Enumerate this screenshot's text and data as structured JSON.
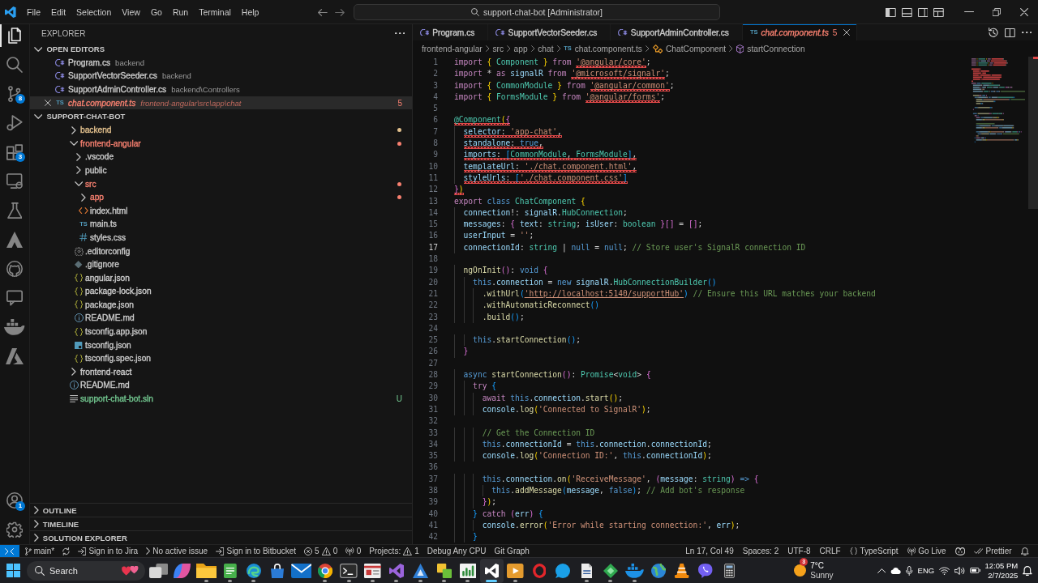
{
  "title_bar": {
    "menu": [
      "File",
      "Edit",
      "Selection",
      "View",
      "Go",
      "Run",
      "Terminal",
      "Help"
    ],
    "command_center": "support-chat-bot [Administrator]"
  },
  "activity_bar": {
    "items": [
      {
        "kind": "explorer",
        "selected": true
      },
      {
        "kind": "search",
        "selected": false
      },
      {
        "kind": "scm",
        "selected": false,
        "badge": "8"
      },
      {
        "kind": "debug",
        "selected": false
      },
      {
        "kind": "extensions",
        "selected": false,
        "badge": "3"
      },
      {
        "kind": "remote",
        "selected": false
      },
      {
        "kind": "testing",
        "selected": false
      },
      {
        "kind": "peak",
        "selected": false
      },
      {
        "kind": "github",
        "selected": false
      },
      {
        "kind": "chat",
        "selected": false
      },
      {
        "kind": "docker",
        "selected": false
      },
      {
        "kind": "azure",
        "selected": false
      }
    ],
    "bottom_items": [
      {
        "kind": "account",
        "badge": "1"
      },
      {
        "kind": "settings"
      }
    ]
  },
  "sidebar": {
    "title": "EXPLORER",
    "open_editors": {
      "title": "OPEN EDITORS",
      "expanded": true,
      "items": [
        {
          "name": "Program.cs",
          "path": "backend",
          "kind": "csharp",
          "color": "#cccccc",
          "preview": false,
          "selected": false
        },
        {
          "name": "SupportVectorSeeder.cs",
          "path": "backend",
          "kind": "csharp",
          "color": "#cccccc",
          "preview": false,
          "selected": false
        },
        {
          "name": "SupportAdminController.cs",
          "path": "backend\\Controllers",
          "kind": "csharp",
          "color": "#cccccc",
          "preview": false,
          "selected": false
        },
        {
          "name": "chat.component.ts",
          "path": "frontend-angular\\src\\app\\chat",
          "kind": "ts",
          "icon_text": "TS",
          "color": "#f88070",
          "preview": true,
          "selected": true,
          "problems": "5"
        }
      ]
    },
    "folder": {
      "title": "SUPPORT-CHAT-BOT",
      "expanded": true,
      "tree": [
        {
          "name": "backend",
          "kind": "folder",
          "expanded": false,
          "color": "#e2c08d",
          "dot": true
        },
        {
          "name": "frontend-angular",
          "kind": "folder",
          "expanded": true,
          "color": "#f88070",
          "dot": true,
          "children": [
            {
              "name": ".vscode",
              "kind": "folder",
              "expanded": false,
              "color": "#cccccc"
            },
            {
              "name": "public",
              "kind": "folder",
              "expanded": false,
              "color": "#cccccc"
            },
            {
              "name": "src",
              "kind": "folder",
              "expanded": true,
              "color": "#f88070",
              "dot": true,
              "children": [
                {
                  "name": "app",
                  "kind": "folder",
                  "expanded": false,
                  "color": "#f88070",
                  "dot": true
                },
                {
                  "name": "index.html",
                  "kind": "html",
                  "color": "#cccccc"
                },
                {
                  "name": "main.ts",
                  "kind": "ts",
                  "icon_text": "TS",
                  "color": "#cccccc"
                },
                {
                  "name": "styles.css",
                  "kind": "css",
                  "color": "#cccccc"
                }
              ]
            },
            {
              "name": ".editorconfig",
              "kind": "config",
              "color": "#cccccc"
            },
            {
              "name": ".gitignore",
              "kind": "git",
              "color": "#cccccc"
            },
            {
              "name": "angular.json",
              "kind": "json",
              "color": "#cccccc"
            },
            {
              "name": "package-lock.json",
              "kind": "json",
              "color": "#cccccc"
            },
            {
              "name": "package.json",
              "kind": "json",
              "color": "#cccccc"
            },
            {
              "name": "README.md",
              "kind": "info",
              "color": "#cccccc"
            },
            {
              "name": "tsconfig.app.json",
              "kind": "json",
              "color": "#cccccc"
            },
            {
              "name": "tsconfig.json",
              "kind": "tsconfig",
              "color": "#cccccc"
            },
            {
              "name": "tsconfig.spec.json",
              "kind": "json",
              "color": "#cccccc"
            }
          ]
        },
        {
          "name": "frontend-react",
          "kind": "folder",
          "expanded": false,
          "color": "#cccccc"
        },
        {
          "name": "README.md",
          "kind": "info",
          "color": "#cccccc"
        },
        {
          "name": "support-chat-bot.sln",
          "kind": "solution",
          "color": "#73c991",
          "badge": "U"
        }
      ]
    },
    "sections": [
      {
        "title": "OUTLINE",
        "expanded": false
      },
      {
        "title": "TIMELINE",
        "expanded": false
      },
      {
        "title": "SOLUTION EXPLORER",
        "expanded": false
      }
    ]
  },
  "editor": {
    "tabs": [
      {
        "label": "Program.cs",
        "kind": "csharp",
        "color": "#cccccc",
        "preview": false,
        "selected": false
      },
      {
        "label": "SupportVectorSeeder.cs",
        "kind": "csharp",
        "color": "#cccccc",
        "preview": false,
        "selected": false
      },
      {
        "label": "SupportAdminController.cs",
        "kind": "csharp",
        "color": "#cccccc",
        "preview": false,
        "selected": false
      },
      {
        "label": "chat.component.ts",
        "kind": "ts",
        "icon_text": "TS",
        "color": "#f88070",
        "preview": true,
        "selected": true,
        "problems": "5"
      }
    ],
    "breadcrumbs": [
      {
        "kind": "folder",
        "text": "frontend-angular"
      },
      {
        "kind": "folder",
        "text": "src"
      },
      {
        "kind": "folder",
        "text": "app"
      },
      {
        "kind": "folder",
        "text": "chat"
      },
      {
        "kind": "ts",
        "icon_text": "TS",
        "text": "chat.component.ts"
      },
      {
        "kind": "class",
        "text": "ChatComponent"
      },
      {
        "kind": "method",
        "text": "startConnection"
      }
    ],
    "lines": [
      {
        "number": "1",
        "active": false,
        "tokens": [
          {
            "kind": "keyword",
            "text": "import "
          },
          {
            "kind": "bracket1",
            "text": "{ "
          },
          {
            "kind": "type",
            "text": "Component "
          },
          {
            "kind": "bracket1",
            "text": "} "
          },
          {
            "kind": "keyword",
            "text": "from "
          },
          {
            "kind": "string",
            "text": "'@angular/core'",
            "error": true
          },
          {
            "kind": "plain",
            "text": ";"
          }
        ]
      },
      {
        "number": "2",
        "active": false,
        "tokens": [
          {
            "kind": "keyword",
            "text": "import "
          },
          {
            "kind": "plain",
            "text": "* "
          },
          {
            "kind": "keyword",
            "text": "as "
          },
          {
            "kind": "variable",
            "text": "signalR "
          },
          {
            "kind": "keyword",
            "text": "from "
          },
          {
            "kind": "string",
            "text": "'@microsoft/signalr'",
            "error": true
          },
          {
            "kind": "plain",
            "text": ";"
          }
        ]
      },
      {
        "number": "3",
        "active": false,
        "tokens": [
          {
            "kind": "keyword",
            "text": "import "
          },
          {
            "kind": "bracket1",
            "text": "{ "
          },
          {
            "kind": "type",
            "text": "CommonModule "
          },
          {
            "kind": "bracket1",
            "text": "} "
          },
          {
            "kind": "keyword",
            "text": "from "
          },
          {
            "kind": "string",
            "text": "'@angular/common'",
            "error": true
          },
          {
            "kind": "plain",
            "text": ";"
          }
        ]
      },
      {
        "number": "4",
        "active": false,
        "tokens": [
          {
            "kind": "keyword",
            "text": "import "
          },
          {
            "kind": "bracket1",
            "text": "{ "
          },
          {
            "kind": "type",
            "text": "FormsModule "
          },
          {
            "kind": "bracket1",
            "text": "} "
          },
          {
            "kind": "keyword",
            "text": "from "
          },
          {
            "kind": "string",
            "text": "'@angular/forms'",
            "error": true
          },
          {
            "kind": "plain",
            "text": ";"
          }
        ]
      },
      {
        "number": "5",
        "active": false
      },
      {
        "number": "6",
        "active": false,
        "tokens": [
          {
            "kind": "type",
            "text": "@Component",
            "error": true
          },
          {
            "kind": "bracket1",
            "text": "(",
            "error": true
          },
          {
            "kind": "bracket2",
            "text": "{",
            "error": true
          }
        ]
      },
      {
        "number": "7",
        "active": false,
        "tokens": [
          {
            "kind": "variable",
            "text": "  selector",
            "error": true
          },
          {
            "kind": "plain",
            "text": ": ",
            "error": true
          },
          {
            "kind": "string",
            "text": "'app-chat'",
            "error": true
          },
          {
            "kind": "plain",
            "text": ",",
            "error": true
          }
        ]
      },
      {
        "number": "8",
        "active": false,
        "tokens": [
          {
            "kind": "variable",
            "text": "  standalone",
            "error": true
          },
          {
            "kind": "plain",
            "text": ": ",
            "error": true
          },
          {
            "kind": "storage",
            "text": "true",
            "error": true
          },
          {
            "kind": "plain",
            "text": ",",
            "error": true
          }
        ]
      },
      {
        "number": "9",
        "active": false,
        "tokens": [
          {
            "kind": "variable",
            "text": "  imports",
            "error": true
          },
          {
            "kind": "plain",
            "text": ": ",
            "error": true
          },
          {
            "kind": "bracket3",
            "text": "[",
            "error": true
          },
          {
            "kind": "type",
            "text": "CommonModule",
            "error": true
          },
          {
            "kind": "plain",
            "text": ", ",
            "error": true
          },
          {
            "kind": "type",
            "text": "FormsModule",
            "error": true
          },
          {
            "kind": "bracket3",
            "text": "]",
            "error": true
          },
          {
            "kind": "plain",
            "text": ",",
            "error": true
          }
        ]
      },
      {
        "number": "10",
        "active": false,
        "tokens": [
          {
            "kind": "variable",
            "text": "  templateUrl",
            "error": true
          },
          {
            "kind": "plain",
            "text": ": ",
            "error": true
          },
          {
            "kind": "string",
            "text": "'./chat.component.html'",
            "error": true
          },
          {
            "kind": "plain",
            "text": ",",
            "error": true
          }
        ]
      },
      {
        "number": "11",
        "active": false,
        "tokens": [
          {
            "kind": "variable",
            "text": "  styleUrls",
            "error": true
          },
          {
            "kind": "plain",
            "text": ": ",
            "error": true
          },
          {
            "kind": "bracket3",
            "text": "[",
            "error": true
          },
          {
            "kind": "string",
            "text": "'./chat.component.css'",
            "error": true
          },
          {
            "kind": "bracket3",
            "text": "]",
            "error": true
          }
        ]
      },
      {
        "number": "12",
        "active": false,
        "tokens": [
          {
            "kind": "bracket2",
            "text": "}",
            "error": true
          },
          {
            "kind": "bracket1",
            "text": ")",
            "error": true
          }
        ]
      },
      {
        "number": "13",
        "active": false,
        "tokens": [
          {
            "kind": "keyword",
            "text": "export "
          },
          {
            "kind": "storage",
            "text": "class "
          },
          {
            "kind": "type",
            "text": "ChatComponent "
          },
          {
            "kind": "bracket1",
            "text": "{"
          }
        ]
      },
      {
        "number": "14",
        "active": false,
        "tokens": [
          {
            "kind": "variable",
            "text": "  connection"
          },
          {
            "kind": "plain",
            "text": "!: "
          },
          {
            "kind": "variable",
            "text": "signalR"
          },
          {
            "kind": "plain",
            "text": "."
          },
          {
            "kind": "type",
            "text": "HubConnection"
          },
          {
            "kind": "plain",
            "text": ";"
          }
        ]
      },
      {
        "number": "15",
        "active": false,
        "tokens": [
          {
            "kind": "variable",
            "text": "  messages"
          },
          {
            "kind": "plain",
            "text": ": "
          },
          {
            "kind": "bracket2",
            "text": "{ "
          },
          {
            "kind": "variable",
            "text": "text"
          },
          {
            "kind": "plain",
            "text": ": "
          },
          {
            "kind": "type",
            "text": "string"
          },
          {
            "kind": "plain",
            "text": "; "
          },
          {
            "kind": "variable",
            "text": "isUser"
          },
          {
            "kind": "plain",
            "text": ": "
          },
          {
            "kind": "type",
            "text": "boolean "
          },
          {
            "kind": "bracket2",
            "text": "}[]"
          },
          {
            "kind": "plain",
            "text": " = "
          },
          {
            "kind": "bracket2",
            "text": "[]"
          },
          {
            "kind": "plain",
            "text": ";"
          }
        ]
      },
      {
        "number": "16",
        "active": false,
        "tokens": [
          {
            "kind": "variable",
            "text": "  userInput"
          },
          {
            "kind": "plain",
            "text": " = "
          },
          {
            "kind": "string",
            "text": "''"
          },
          {
            "kind": "plain",
            "text": ";"
          }
        ]
      },
      {
        "number": "17",
        "active": true,
        "tokens": [
          {
            "kind": "variable",
            "text": "  connectionId"
          },
          {
            "kind": "plain",
            "text": ": "
          },
          {
            "kind": "type",
            "text": "string "
          },
          {
            "kind": "plain",
            "text": "| "
          },
          {
            "kind": "storage",
            "text": "null"
          },
          {
            "kind": "plain",
            "text": " = "
          },
          {
            "kind": "storage",
            "text": "null"
          },
          {
            "kind": "plain",
            "text": "; "
          },
          {
            "kind": "comment",
            "text": "// Store user's SignalR connection ID"
          }
        ]
      },
      {
        "number": "18",
        "active": false
      },
      {
        "number": "19",
        "active": false,
        "tokens": [
          {
            "kind": "function",
            "text": "  ngOnInit"
          },
          {
            "kind": "bracket2",
            "text": "()"
          },
          {
            "kind": "plain",
            "text": ": "
          },
          {
            "kind": "storage",
            "text": "void "
          },
          {
            "kind": "bracket2",
            "text": "{"
          }
        ]
      },
      {
        "number": "20",
        "active": false,
        "tokens": [
          {
            "kind": "storage",
            "text": "    this"
          },
          {
            "kind": "plain",
            "text": "."
          },
          {
            "kind": "variable",
            "text": "connection"
          },
          {
            "kind": "plain",
            "text": " = "
          },
          {
            "kind": "storage",
            "text": "new "
          },
          {
            "kind": "variable",
            "text": "signalR"
          },
          {
            "kind": "plain",
            "text": "."
          },
          {
            "kind": "type",
            "text": "HubConnectionBuilder"
          },
          {
            "kind": "bracket3",
            "text": "()"
          }
        ]
      },
      {
        "number": "21",
        "active": false,
        "tokens": [
          {
            "kind": "function",
            "text": "      .withUrl"
          },
          {
            "kind": "bracket3",
            "text": "("
          },
          {
            "kind": "link",
            "text": "'http://localhost:5140/supportHub'"
          },
          {
            "kind": "bracket3",
            "text": ") "
          },
          {
            "kind": "comment",
            "text": "// Ensure this URL matches your backend"
          }
        ]
      },
      {
        "number": "22",
        "active": false,
        "tokens": [
          {
            "kind": "function",
            "text": "      .withAutomaticReconnect"
          },
          {
            "kind": "bracket3",
            "text": "()"
          }
        ]
      },
      {
        "number": "23",
        "active": false,
        "tokens": [
          {
            "kind": "function",
            "text": "      .build"
          },
          {
            "kind": "bracket3",
            "text": "()"
          },
          {
            "kind": "plain",
            "text": ";"
          }
        ]
      },
      {
        "number": "24",
        "active": false
      },
      {
        "number": "25",
        "active": false,
        "tokens": [
          {
            "kind": "storage",
            "text": "    this"
          },
          {
            "kind": "plain",
            "text": "."
          },
          {
            "kind": "function",
            "text": "startConnection"
          },
          {
            "kind": "bracket3",
            "text": "()"
          },
          {
            "kind": "plain",
            "text": ";"
          }
        ]
      },
      {
        "number": "26",
        "active": false,
        "tokens": [
          {
            "kind": "bracket2",
            "text": "  }"
          }
        ]
      },
      {
        "number": "27",
        "active": false
      },
      {
        "number": "28",
        "active": false,
        "tokens": [
          {
            "kind": "storage",
            "text": "  async "
          },
          {
            "kind": "function",
            "text": "startConnection"
          },
          {
            "kind": "bracket2",
            "text": "()"
          },
          {
            "kind": "plain",
            "text": ": "
          },
          {
            "kind": "type",
            "text": "Promise"
          },
          {
            "kind": "plain",
            "text": "<"
          },
          {
            "kind": "type",
            "text": "void"
          },
          {
            "kind": "plain",
            "text": "> "
          },
          {
            "kind": "bracket2",
            "text": "{"
          }
        ]
      },
      {
        "number": "29",
        "active": false,
        "tokens": [
          {
            "kind": "keyword",
            "text": "    try "
          },
          {
            "kind": "bracket3",
            "text": "{"
          }
        ]
      },
      {
        "number": "30",
        "active": false,
        "tokens": [
          {
            "kind": "keyword",
            "text": "      await "
          },
          {
            "kind": "storage",
            "text": "this"
          },
          {
            "kind": "plain",
            "text": "."
          },
          {
            "kind": "variable",
            "text": "connection"
          },
          {
            "kind": "plain",
            "text": "."
          },
          {
            "kind": "function",
            "text": "start"
          },
          {
            "kind": "bracket1",
            "text": "()"
          },
          {
            "kind": "plain",
            "text": ";"
          }
        ]
      },
      {
        "number": "31",
        "active": false,
        "tokens": [
          {
            "kind": "variable",
            "text": "      console"
          },
          {
            "kind": "plain",
            "text": "."
          },
          {
            "kind": "function",
            "text": "log"
          },
          {
            "kind": "bracket1",
            "text": "("
          },
          {
            "kind": "string",
            "text": "'Connected to SignalR'"
          },
          {
            "kind": "bracket1",
            "text": ")"
          },
          {
            "kind": "plain",
            "text": ";"
          }
        ]
      },
      {
        "number": "32",
        "active": false
      },
      {
        "number": "33",
        "active": false,
        "tokens": [
          {
            "kind": "comment",
            "text": "      // Get the Connection ID"
          }
        ]
      },
      {
        "number": "34",
        "active": false,
        "tokens": [
          {
            "kind": "storage",
            "text": "      this"
          },
          {
            "kind": "plain",
            "text": "."
          },
          {
            "kind": "variable",
            "text": "connectionId"
          },
          {
            "kind": "plain",
            "text": " = "
          },
          {
            "kind": "storage",
            "text": "this"
          },
          {
            "kind": "plain",
            "text": "."
          },
          {
            "kind": "variable",
            "text": "connection"
          },
          {
            "kind": "plain",
            "text": "."
          },
          {
            "kind": "variable",
            "text": "connectionId"
          },
          {
            "kind": "plain",
            "text": ";"
          }
        ]
      },
      {
        "number": "35",
        "active": false,
        "tokens": [
          {
            "kind": "variable",
            "text": "      console"
          },
          {
            "kind": "plain",
            "text": "."
          },
          {
            "kind": "function",
            "text": "log"
          },
          {
            "kind": "bracket1",
            "text": "("
          },
          {
            "kind": "string",
            "text": "'Connection ID:'"
          },
          {
            "kind": "plain",
            "text": ", "
          },
          {
            "kind": "storage",
            "text": "this"
          },
          {
            "kind": "plain",
            "text": "."
          },
          {
            "kind": "variable",
            "text": "connectionId"
          },
          {
            "kind": "bracket1",
            "text": ")"
          },
          {
            "kind": "plain",
            "text": ";"
          }
        ]
      },
      {
        "number": "36",
        "active": false
      },
      {
        "number": "37",
        "active": false,
        "tokens": [
          {
            "kind": "storage",
            "text": "      this"
          },
          {
            "kind": "plain",
            "text": "."
          },
          {
            "kind": "variable",
            "text": "connection"
          },
          {
            "kind": "plain",
            "text": "."
          },
          {
            "kind": "function",
            "text": "on"
          },
          {
            "kind": "bracket1",
            "text": "("
          },
          {
            "kind": "string",
            "text": "'ReceiveMessage'"
          },
          {
            "kind": "plain",
            "text": ", "
          },
          {
            "kind": "bracket2",
            "text": "("
          },
          {
            "kind": "variable",
            "text": "message"
          },
          {
            "kind": "plain",
            "text": ": "
          },
          {
            "kind": "type",
            "text": "string"
          },
          {
            "kind": "bracket2",
            "text": ") "
          },
          {
            "kind": "storage",
            "text": "=> "
          },
          {
            "kind": "bracket2",
            "text": "{"
          }
        ]
      },
      {
        "number": "38",
        "active": false,
        "tokens": [
          {
            "kind": "storage",
            "text": "        this"
          },
          {
            "kind": "plain",
            "text": "."
          },
          {
            "kind": "function",
            "text": "addMessage"
          },
          {
            "kind": "bracket3",
            "text": "("
          },
          {
            "kind": "variable",
            "text": "message"
          },
          {
            "kind": "plain",
            "text": ", "
          },
          {
            "kind": "storage",
            "text": "false"
          },
          {
            "kind": "bracket3",
            "text": ")"
          },
          {
            "kind": "plain",
            "text": "; "
          },
          {
            "kind": "comment",
            "text": "// Add bot's response"
          }
        ]
      },
      {
        "number": "39",
        "active": false,
        "tokens": [
          {
            "kind": "bracket2",
            "text": "      }"
          },
          {
            "kind": "bracket1",
            "text": ")"
          },
          {
            "kind": "plain",
            "text": ";"
          }
        ]
      },
      {
        "number": "40",
        "active": false,
        "tokens": [
          {
            "kind": "bracket3",
            "text": "    } "
          },
          {
            "kind": "keyword",
            "text": "catch "
          },
          {
            "kind": "bracket2",
            "text": "("
          },
          {
            "kind": "variable",
            "text": "err"
          },
          {
            "kind": "bracket2",
            "text": ") "
          },
          {
            "kind": "bracket3",
            "text": "{"
          }
        ]
      },
      {
        "number": "41",
        "active": false,
        "tokens": [
          {
            "kind": "variable",
            "text": "      console"
          },
          {
            "kind": "plain",
            "text": "."
          },
          {
            "kind": "function",
            "text": "error"
          },
          {
            "kind": "bracket1",
            "text": "("
          },
          {
            "kind": "string",
            "text": "'Error while starting connection:'"
          },
          {
            "kind": "plain",
            "text": ", "
          },
          {
            "kind": "variable",
            "text": "err"
          },
          {
            "kind": "bracket1",
            "text": ")"
          },
          {
            "kind": "plain",
            "text": ";"
          }
        ]
      },
      {
        "number": "42",
        "active": false,
        "tokens": [
          {
            "kind": "bracket3",
            "text": "    }"
          }
        ]
      }
    ]
  },
  "status_bar": {
    "left": [
      {
        "kind": "remote"
      },
      {
        "kind": "branch",
        "text": "main*"
      },
      {
        "kind": "sync"
      },
      {
        "kind": "signin",
        "text": "Sign in to Jira"
      },
      {
        "kind": "issue",
        "text": "No active issue"
      },
      {
        "kind": "signin",
        "text": "Sign in to Bitbucket"
      },
      {
        "kind": "problems",
        "errors": "5",
        "warnings": "0"
      },
      {
        "kind": "ports",
        "text": "0"
      },
      {
        "kind": "projects",
        "text": "Projects:",
        "count": "1"
      },
      {
        "kind": "text",
        "text": "Debug Any CPU"
      },
      {
        "kind": "text",
        "text": "Git Graph"
      }
    ],
    "right": [
      {
        "kind": "text",
        "text": "Ln 17, Col 49"
      },
      {
        "kind": "text",
        "text": "Spaces: 2"
      },
      {
        "kind": "text",
        "text": "UTF-8"
      },
      {
        "kind": "text",
        "text": "CRLF"
      },
      {
        "kind": "language",
        "text": "TypeScript"
      },
      {
        "kind": "live",
        "text": "Go Live"
      },
      {
        "kind": "copilot"
      },
      {
        "kind": "prettier",
        "text": "Prettier"
      },
      {
        "kind": "bell"
      }
    ]
  },
  "taskbar": {
    "search": {
      "placeholder": "Search"
    },
    "apps": [
      {
        "kind": "taskview",
        "running": false,
        "selected": false
      },
      {
        "kind": "copilot",
        "running": false,
        "selected": false
      },
      {
        "kind": "files",
        "running": true,
        "selected": false
      },
      {
        "kind": "notepad",
        "running": true,
        "selected": false
      },
      {
        "kind": "edge",
        "running": true,
        "selected": false
      },
      {
        "kind": "store",
        "running": false,
        "selected": false
      },
      {
        "kind": "mail",
        "running": false,
        "selected": false
      },
      {
        "kind": "chrome",
        "running": true,
        "selected": false
      },
      {
        "kind": "terminal",
        "running": true,
        "selected": false
      },
      {
        "kind": "window",
        "running": true,
        "selected": false
      },
      {
        "kind": "studio",
        "running": true,
        "selected": false
      },
      {
        "kind": "datastudio",
        "running": true,
        "selected": false
      },
      {
        "kind": "squares",
        "running": true,
        "selected": false
      },
      {
        "kind": "chart",
        "running": true,
        "selected": false
      },
      {
        "kind": "vscode",
        "running": true,
        "selected": true
      },
      {
        "kind": "media",
        "running": true,
        "selected": false
      },
      {
        "kind": "opera",
        "running": false,
        "selected": false
      },
      {
        "kind": "skype",
        "running": false,
        "selected": false
      },
      {
        "kind": "document",
        "running": true,
        "selected": false
      },
      {
        "kind": "diamond",
        "running": true,
        "selected": false
      },
      {
        "kind": "docker",
        "running": true,
        "selected": false
      },
      {
        "kind": "globe",
        "running": false,
        "selected": false
      },
      {
        "kind": "vlc",
        "running": false,
        "selected": false
      },
      {
        "kind": "viber",
        "running": false,
        "selected": false
      },
      {
        "kind": "calculator",
        "running": false,
        "selected": false
      }
    ],
    "weather": {
      "badge": "3",
      "temperature": "7°C",
      "condition": "Sunny"
    },
    "tray": {
      "language": "ENG",
      "time": "12:05 PM",
      "date": "2/7/2025"
    }
  }
}
